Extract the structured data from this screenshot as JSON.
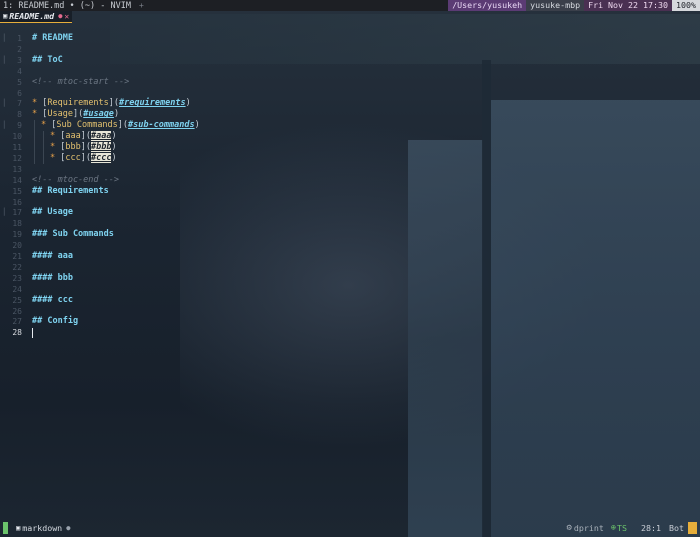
{
  "titlebar": {
    "title": "1: README.md • (~) - NVIM",
    "plus": "+",
    "path": "/Users/yusukeh",
    "host": "yusuke-mbp",
    "datetime": "Fri Nov 22 17:30",
    "battery": "100%"
  },
  "tab": {
    "icon": "markdown-icon",
    "name": "README.md",
    "modified": "●",
    "close": "✕"
  },
  "editor": {
    "current_line": 28,
    "lines": [
      {
        "n": "1",
        "fold": "│",
        "text": "# README"
      },
      {
        "n": "2",
        "fold": "",
        "text": ""
      },
      {
        "n": "3",
        "fold": "│",
        "text": "## ToC"
      },
      {
        "n": "4",
        "fold": "",
        "text": ""
      },
      {
        "n": "5",
        "fold": "",
        "text": "<!-- mtoc-start -->"
      },
      {
        "n": "6",
        "fold": "",
        "text": ""
      },
      {
        "n": "7",
        "fold": "│",
        "bullet": "*",
        "label": "Requirements",
        "anchor": "#requirements"
      },
      {
        "n": "8",
        "fold": "",
        "bullet": "*",
        "label": "Usage",
        "anchor": "#usage"
      },
      {
        "n": "9",
        "fold": "│",
        "bullet": "*",
        "label": "Sub Commands",
        "anchor": "#sub-commands"
      },
      {
        "n": "10",
        "fold": "",
        "bullet": "*",
        "label": "aaa",
        "anchor": "#aaa"
      },
      {
        "n": "11",
        "fold": "",
        "bullet": "*",
        "label": "bbb",
        "anchor": "#bbb"
      },
      {
        "n": "12",
        "fold": "",
        "bullet": "*",
        "label": "ccc",
        "anchor": "#ccc"
      },
      {
        "n": "13",
        "fold": "",
        "text": ""
      },
      {
        "n": "14",
        "fold": "",
        "text": "<!-- mtoc-end -->"
      },
      {
        "n": "15",
        "fold": "",
        "text": "## Requirements"
      },
      {
        "n": "16",
        "fold": "",
        "text": ""
      },
      {
        "n": "17",
        "fold": "│",
        "text": "## Usage"
      },
      {
        "n": "18",
        "fold": "",
        "text": ""
      },
      {
        "n": "19",
        "fold": "",
        "text": "### Sub Commands"
      },
      {
        "n": "20",
        "fold": "",
        "text": ""
      },
      {
        "n": "21",
        "fold": "",
        "text": "#### aaa"
      },
      {
        "n": "22",
        "fold": "",
        "text": ""
      },
      {
        "n": "23",
        "fold": "",
        "text": "#### bbb"
      },
      {
        "n": "24",
        "fold": "",
        "text": ""
      },
      {
        "n": "25",
        "fold": "",
        "text": "#### ccc"
      },
      {
        "n": "26",
        "fold": "",
        "text": ""
      },
      {
        "n": "27",
        "fold": "",
        "text": "## Config"
      },
      {
        "n": "28",
        "fold": "",
        "text": ""
      }
    ]
  },
  "statusline": {
    "filetype_icon": "markdown-icon",
    "filetype": "markdown",
    "dot": "●",
    "lsp_icon": "gear-icon",
    "lsp": "dprint",
    "ts_icon": "check-circle-icon",
    "ts": "TS",
    "position": "28:1",
    "scroll": "Bot"
  },
  "colors": {
    "accent": "#e6ae3b",
    "heading": "#7fd3f0",
    "comment": "#6d7784",
    "mode_left": "#6bc36b"
  }
}
